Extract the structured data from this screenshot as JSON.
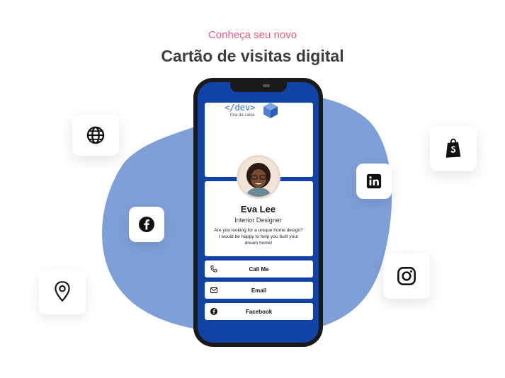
{
  "hero": {
    "eyebrow": "Conheça seu novo",
    "headline": "Cartão de visitas digital"
  },
  "colors": {
    "accent": "#ec5a7a",
    "blob": "#7f9fd8",
    "screen": "#1142a8"
  },
  "floating_icons": [
    {
      "icon": "globe-icon"
    },
    {
      "icon": "facebook-icon"
    },
    {
      "icon": "location-pin-icon"
    },
    {
      "icon": "linkedin-icon"
    },
    {
      "icon": "shopify-icon"
    },
    {
      "icon": "instagram-icon"
    }
  ],
  "card": {
    "logo_code": "</dev>",
    "logo_sub": "fora da caixa",
    "name": "Eva Lee",
    "role": "Interior Designer",
    "bio": "Are you looking for a unique home design? I would be happy to help you built your dream home!",
    "buttons": [
      {
        "label": "Call Me",
        "icon": "phone-icon"
      },
      {
        "label": "Email",
        "icon": "mail-icon"
      },
      {
        "label": "Facebook",
        "icon": "facebook-icon"
      }
    ]
  }
}
